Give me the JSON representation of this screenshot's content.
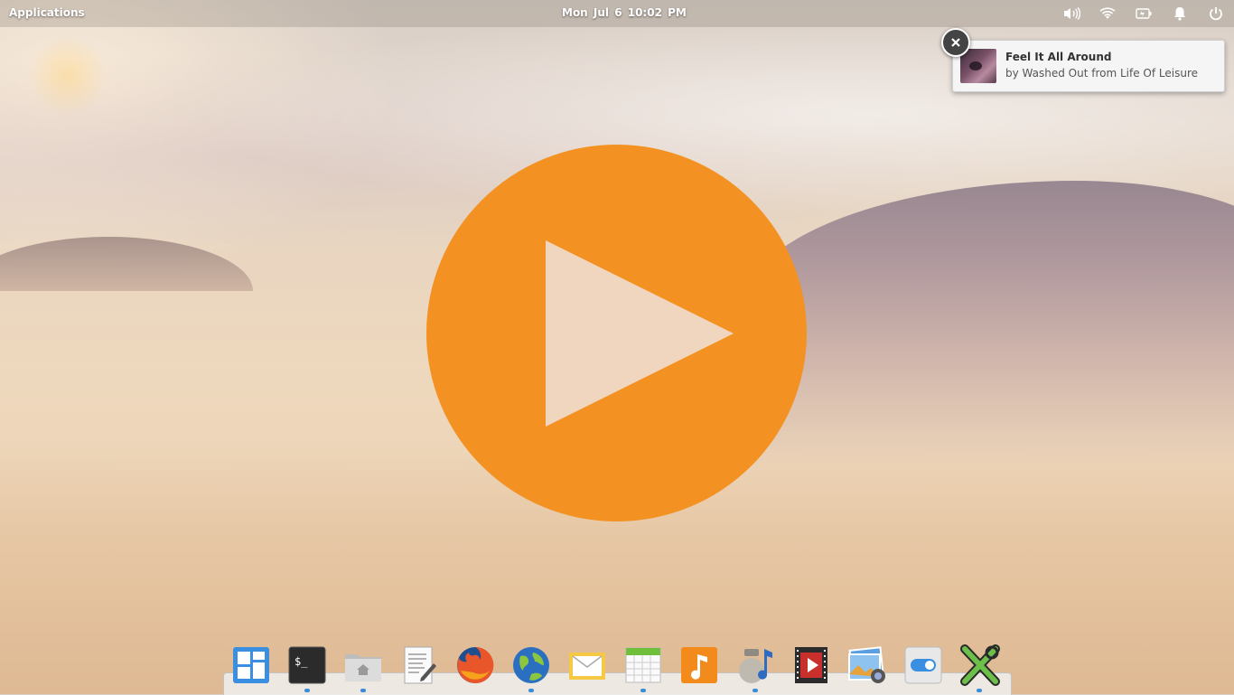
{
  "panel": {
    "applications_label": "Applications",
    "clock": "Mon Jul  6   10:02 PM",
    "tray_icons": [
      "volume-icon",
      "wifi-icon",
      "battery-icon",
      "notifications-bell-icon",
      "power-icon"
    ]
  },
  "notification": {
    "title": "Feel It All Around",
    "body": "by Washed Out from Life Of Leisure"
  },
  "dock": {
    "items": [
      {
        "name": "multitasking-view",
        "icon": "multitasking-icon",
        "running": false
      },
      {
        "name": "terminal",
        "icon": "terminal-icon",
        "running": true
      },
      {
        "name": "files",
        "icon": "folder-home-icon",
        "running": true
      },
      {
        "name": "scratch-text-editor",
        "icon": "text-editor-icon",
        "running": false
      },
      {
        "name": "firefox",
        "icon": "firefox-icon",
        "running": false
      },
      {
        "name": "web-browser",
        "icon": "globe-icon",
        "running": true
      },
      {
        "name": "mail",
        "icon": "mail-icon",
        "running": false
      },
      {
        "name": "calendar",
        "icon": "calendar-icon",
        "running": true
      },
      {
        "name": "music",
        "icon": "music-note-icon",
        "running": false
      },
      {
        "name": "audio-player",
        "icon": "audio-jar-icon",
        "running": true
      },
      {
        "name": "videos",
        "icon": "video-film-icon",
        "running": false
      },
      {
        "name": "photos",
        "icon": "photos-icon",
        "running": false
      },
      {
        "name": "system-settings",
        "icon": "toggle-switch-icon",
        "running": false
      },
      {
        "name": "x-app",
        "icon": "x-tools-icon",
        "running": true
      }
    ]
  },
  "colors": {
    "play_accent": "#f39222",
    "running_indicator": "#3b8bd8"
  }
}
